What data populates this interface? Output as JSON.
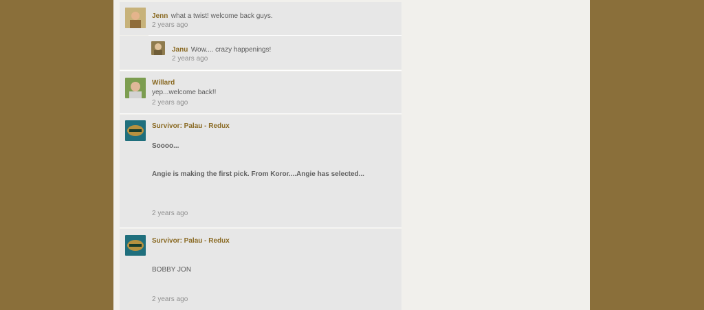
{
  "comments": [
    {
      "author": "Jenn",
      "text": "what a twist! welcome back guys.",
      "time": "2 years ago"
    },
    {
      "author": "Janu",
      "text": "Wow.... crazy happenings!",
      "time": "2 years ago"
    },
    {
      "author": "Willard",
      "text": "yep...welcome back!!",
      "time": "2 years ago"
    },
    {
      "author": "Survivor: Palau - Redux",
      "lines": [
        "Soooo...",
        "Angie is making the first pick.  From Koror....Angie has selected..."
      ],
      "time": "2 years ago"
    },
    {
      "author": "Survivor: Palau - Redux",
      "lines": [
        "BOBBY JON"
      ],
      "time": "2 years ago"
    }
  ],
  "colors": {
    "background": "#8a6f3a",
    "page": "#f1f0ec",
    "comment_bg": "#e7e7e7",
    "author": "#8a6a23"
  }
}
